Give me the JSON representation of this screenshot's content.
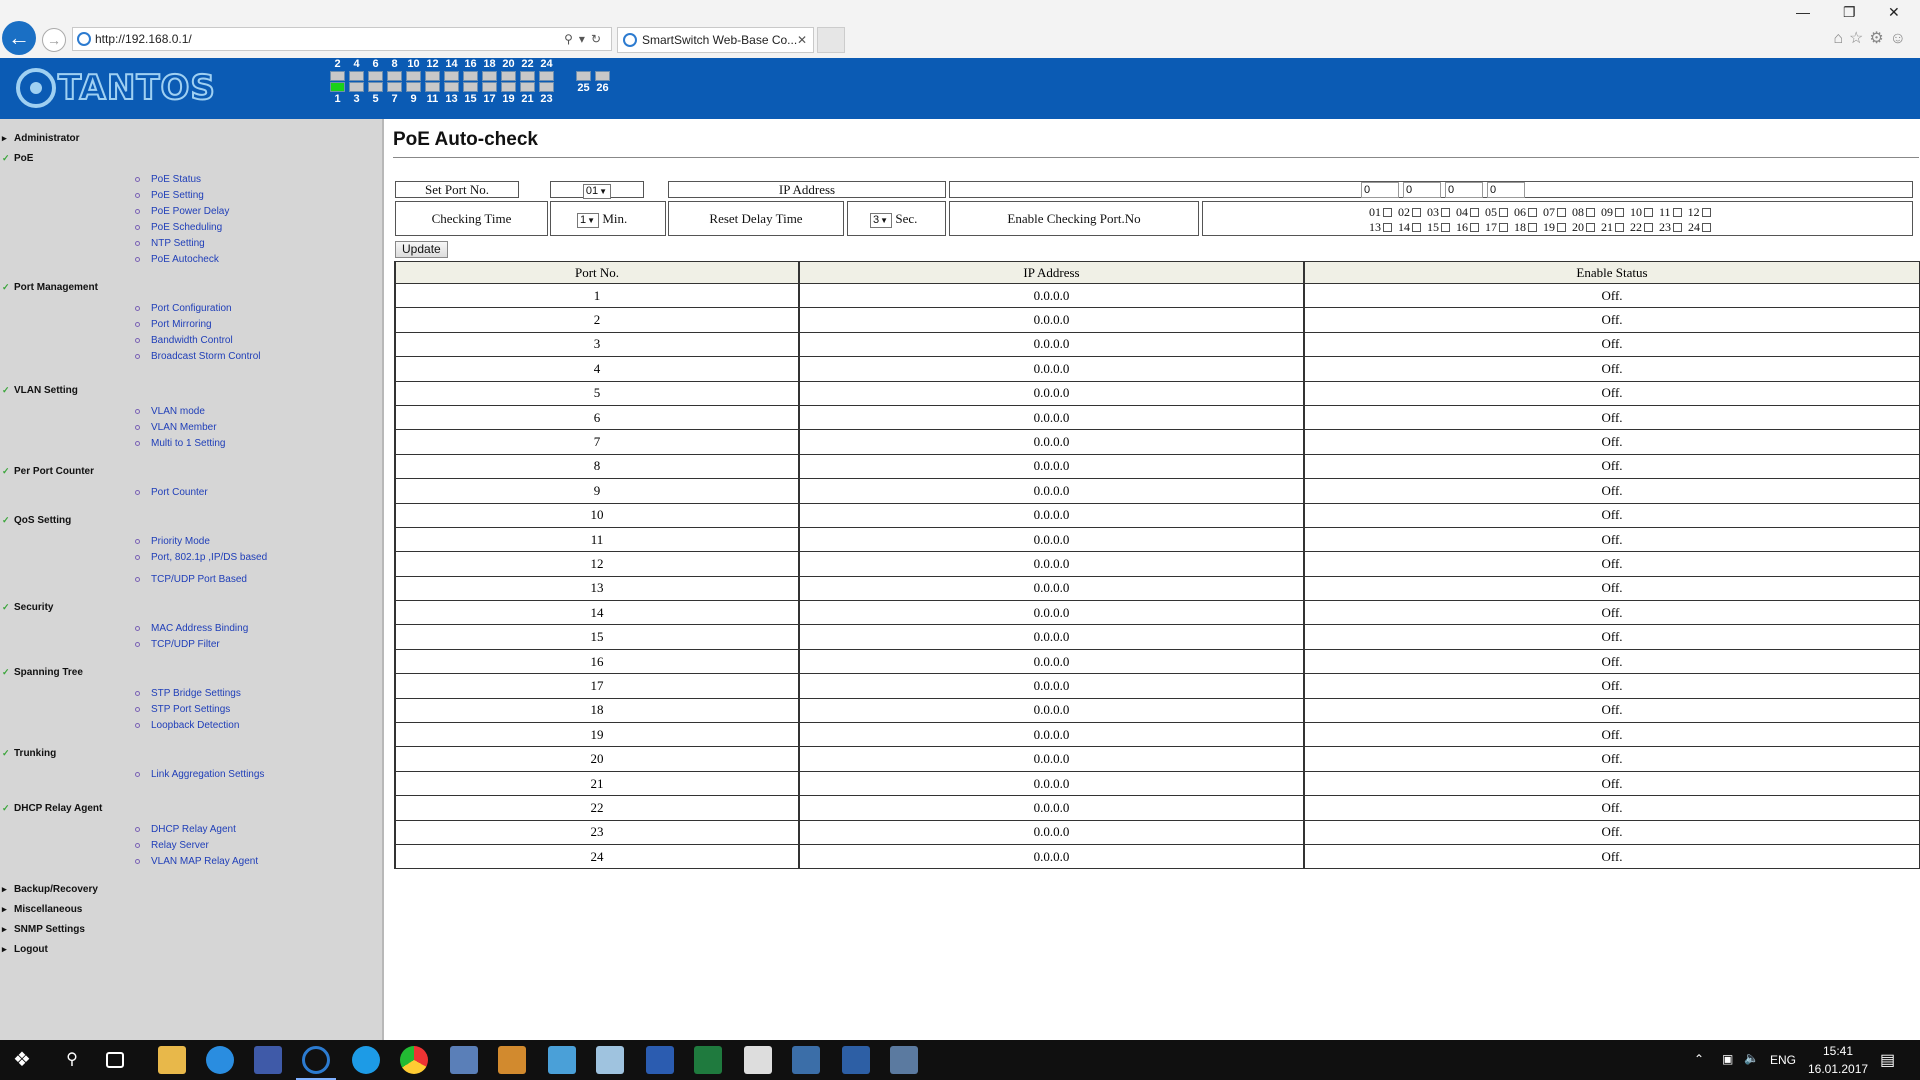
{
  "browser": {
    "url": "http://192.168.0.1/",
    "tab_title": "SmartSwitch Web-Base Co...",
    "back_icon": "arrow-left-icon",
    "forward_icon": "arrow-right-icon",
    "window_controls": [
      "—",
      "❐",
      "✕"
    ]
  },
  "banner": {
    "logo_text": "TANTOS",
    "top_ports": [
      "2",
      "4",
      "6",
      "8",
      "10",
      "12",
      "14",
      "16",
      "18",
      "20",
      "22",
      "24"
    ],
    "bottom_ports": [
      "1",
      "3",
      "5",
      "7",
      "9",
      "11",
      "13",
      "15",
      "17",
      "19",
      "21",
      "23"
    ],
    "uplink_ports": [
      "25",
      "26"
    ],
    "active_ports": [
      "1"
    ]
  },
  "sidebar": {
    "sections": [
      {
        "label": "Administrator",
        "items": []
      },
      {
        "label": "PoE",
        "items": [
          "PoE Status",
          "PoE Setting",
          "PoE Power Delay",
          "PoE Scheduling",
          "NTP Setting",
          "PoE Autocheck"
        ]
      },
      {
        "label": "Port Management",
        "items": [
          "Port Configuration",
          "Port Mirroring",
          "Bandwidth Control",
          "Broadcast Storm Control"
        ]
      },
      {
        "label": "VLAN Setting",
        "items": [
          "VLAN mode",
          "VLAN Member",
          "Multi to 1 Setting"
        ]
      },
      {
        "label": "Per Port Counter",
        "items": [
          "Port Counter"
        ]
      },
      {
        "label": "QoS Setting",
        "items": [
          "Priority Mode",
          "Port, 802.1p ,IP/DS based",
          "TCP/UDP Port Based"
        ]
      },
      {
        "label": "Security",
        "items": [
          "MAC Address Binding",
          "TCP/UDP Filter"
        ]
      },
      {
        "label": "Spanning Tree",
        "items": [
          "STP Bridge Settings",
          "STP Port Settings",
          "Loopback Detection"
        ]
      },
      {
        "label": "Trunking",
        "items": [
          "Link Aggregation Settings"
        ]
      },
      {
        "label": "DHCP Relay Agent",
        "items": [
          "DHCP Relay Agent",
          "Relay Server",
          "VLAN MAP Relay Agent"
        ]
      },
      {
        "label": "Backup/Recovery",
        "items": []
      },
      {
        "label": "Miscellaneous",
        "items": []
      },
      {
        "label": "SNMP Settings",
        "items": []
      },
      {
        "label": "Logout",
        "items": []
      }
    ]
  },
  "main": {
    "title": "PoE Auto-check",
    "set_port_label": "Set Port No.",
    "set_port_value": "01",
    "ip_address_label": "IP Address",
    "ip_octets": [
      "0",
      "0",
      "0",
      "0"
    ],
    "checking_time_label": "Checking Time",
    "checking_time_value": "1",
    "checking_time_unit": "Min.",
    "reset_delay_label": "Reset Delay Time",
    "reset_delay_value": "3",
    "reset_delay_unit": "Sec.",
    "enable_checking_label": "Enable Checking Port.No",
    "check_ports_row1": [
      "01",
      "02",
      "03",
      "04",
      "05",
      "06",
      "07",
      "08",
      "09",
      "10",
      "11",
      "12"
    ],
    "check_ports_row2": [
      "13",
      "14",
      "15",
      "16",
      "17",
      "18",
      "19",
      "20",
      "21",
      "22",
      "23",
      "24"
    ],
    "update_label": "Update",
    "table": {
      "headers": [
        "Port No.",
        "IP Address",
        "Enable Status"
      ],
      "rows": [
        [
          "1",
          "0.0.0.0",
          "Off."
        ],
        [
          "2",
          "0.0.0.0",
          "Off."
        ],
        [
          "3",
          "0.0.0.0",
          "Off."
        ],
        [
          "4",
          "0.0.0.0",
          "Off."
        ],
        [
          "5",
          "0.0.0.0",
          "Off."
        ],
        [
          "6",
          "0.0.0.0",
          "Off."
        ],
        [
          "7",
          "0.0.0.0",
          "Off."
        ],
        [
          "8",
          "0.0.0.0",
          "Off."
        ],
        [
          "9",
          "0.0.0.0",
          "Off."
        ],
        [
          "10",
          "0.0.0.0",
          "Off."
        ],
        [
          "11",
          "0.0.0.0",
          "Off."
        ],
        [
          "12",
          "0.0.0.0",
          "Off."
        ],
        [
          "13",
          "0.0.0.0",
          "Off."
        ],
        [
          "14",
          "0.0.0.0",
          "Off."
        ],
        [
          "15",
          "0.0.0.0",
          "Off."
        ],
        [
          "16",
          "0.0.0.0",
          "Off."
        ],
        [
          "17",
          "0.0.0.0",
          "Off."
        ],
        [
          "18",
          "0.0.0.0",
          "Off."
        ],
        [
          "19",
          "0.0.0.0",
          "Off."
        ],
        [
          "20",
          "0.0.0.0",
          "Off."
        ],
        [
          "21",
          "0.0.0.0",
          "Off."
        ],
        [
          "22",
          "0.0.0.0",
          "Off."
        ],
        [
          "23",
          "0.0.0.0",
          "Off."
        ],
        [
          "24",
          "0.0.0.0",
          "Off."
        ]
      ]
    }
  },
  "taskbar": {
    "language": "ENG",
    "time": "15:41",
    "date": "16.01.2017",
    "accent": "#7fb0ff"
  }
}
